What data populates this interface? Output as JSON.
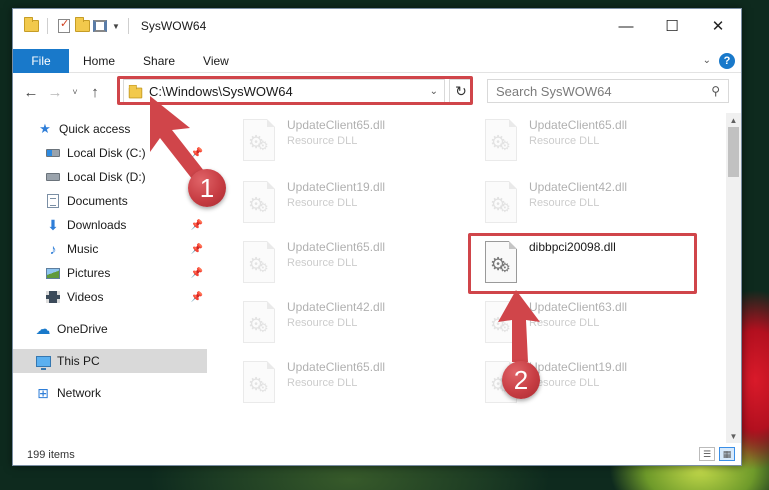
{
  "window": {
    "title": "SysWOW64",
    "controls": {
      "minimize": "—",
      "maximize": "☐",
      "close": "✕"
    }
  },
  "ribbon": {
    "file_tab": "File",
    "tabs": [
      "Home",
      "Share",
      "View"
    ],
    "collapse_icon": "chevron-down-icon",
    "help_label": "?"
  },
  "navigation": {
    "back": "←",
    "forward": "→",
    "recent": "˅",
    "up": "↑",
    "address": "C:\\Windows\\SysWOW64",
    "refresh": "↻"
  },
  "search": {
    "placeholder": "Search SysWOW64"
  },
  "sidebar": {
    "items": [
      {
        "label": "Quick access",
        "icon": "star-icon",
        "pinned": false
      },
      {
        "label": "Local Disk (C:)",
        "icon": "drive-icon",
        "pinned": true
      },
      {
        "label": "Local Disk (D:)",
        "icon": "drive-icon",
        "pinned": true
      },
      {
        "label": "Documents",
        "icon": "documents-icon",
        "pinned": false
      },
      {
        "label": "Downloads",
        "icon": "downloads-icon",
        "pinned": true
      },
      {
        "label": "Music",
        "icon": "music-icon",
        "pinned": true
      },
      {
        "label": "Pictures",
        "icon": "pictures-icon",
        "pinned": true
      },
      {
        "label": "Videos",
        "icon": "videos-icon",
        "pinned": true
      },
      {
        "label": "OneDrive",
        "icon": "cloud-icon",
        "pinned": false
      },
      {
        "label": "This PC",
        "icon": "computer-icon",
        "pinned": false,
        "selected": true
      },
      {
        "label": "Network",
        "icon": "network-icon",
        "pinned": false
      }
    ]
  },
  "files": {
    "type": "Resource DLL",
    "col1": [
      "UpdateClient65.dll",
      "UpdateClient19.dll",
      "UpdateClient65.dll",
      "UpdateClient42.dll",
      "UpdateClient65.dll"
    ],
    "col2": [
      "UpdateClient65.dll",
      "UpdateClient42.dll",
      "dibbpci20098.dll",
      "UpdateClient63.dll",
      "UpdateClient19.dll"
    ],
    "highlighted": "dibbpci20098.dll"
  },
  "status": {
    "item_count": "199 items"
  },
  "annotations": {
    "step1": "1",
    "step2": "2",
    "highlight_color": "#d0454a"
  },
  "colors": {
    "accent": "#1979ca",
    "selection": "#d9d9d9"
  }
}
